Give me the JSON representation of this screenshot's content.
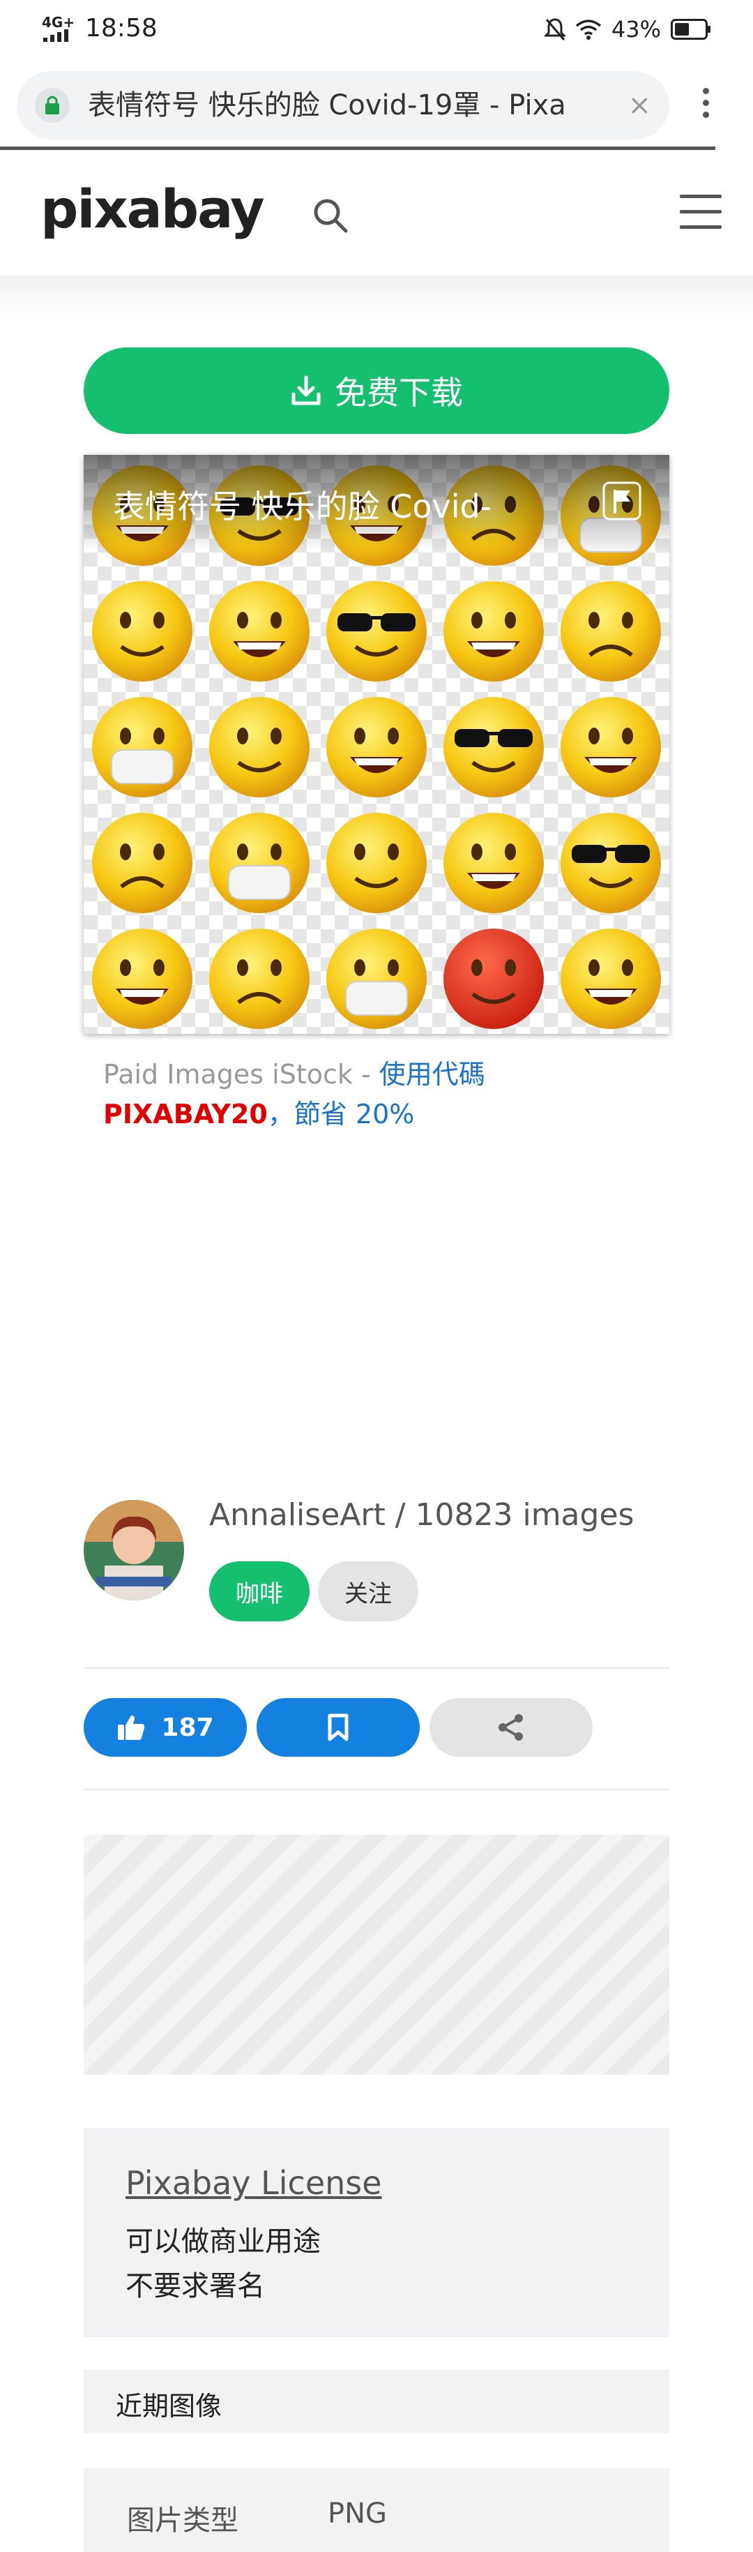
{
  "status_bar": {
    "network": "4G+",
    "time": "18:58",
    "battery": "43%"
  },
  "browser": {
    "tab_title": "表情符号 快乐的脸 Covid-19罩 - Pixa",
    "close_glyph": "×"
  },
  "site": {
    "logo": "pixabay"
  },
  "download": {
    "label": "免费下载"
  },
  "image": {
    "title": "表情符号 快乐的脸 Covid-",
    "emoji_rows": 5,
    "emoji_cols": 5
  },
  "istock": {
    "prefix": "Paid Images iStock - ",
    "code_prompt": "使用代碼",
    "code": "PIXABAY20",
    "separator": "，",
    "saving": "節省 20%"
  },
  "author": {
    "name_line": "AnnaliseArt / 10823 images",
    "coffee_label": "咖啡",
    "follow_label": "关注"
  },
  "actions": {
    "likes": "187"
  },
  "license": {
    "title": "Pixabay License",
    "line1": "可以做商业用途",
    "line2": "不要求署名"
  },
  "recent": {
    "title": "近期图像"
  },
  "info": {
    "label": "图片类型",
    "value": "PNG"
  },
  "colors": {
    "green": "#14c070",
    "blue": "#1480e0",
    "promo_red": "#e00000",
    "link_blue": "#1a73c7"
  }
}
